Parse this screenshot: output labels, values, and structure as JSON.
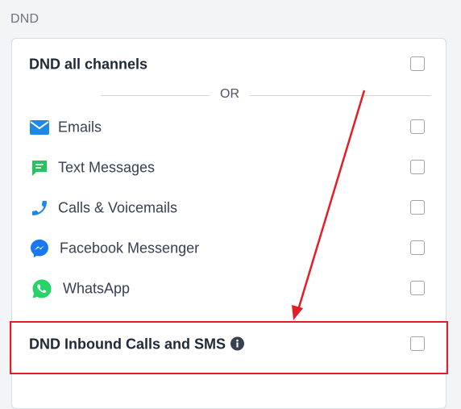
{
  "section": {
    "title": "DND"
  },
  "dnd_all": {
    "label": "DND all channels",
    "checked": false
  },
  "divider": {
    "text": "OR"
  },
  "channels": [
    {
      "label": "Emails",
      "icon": "email-icon",
      "icon_color": "#1e88e5",
      "checked": false
    },
    {
      "label": "Text Messages",
      "icon": "chat-icon",
      "icon_color": "#22c55e",
      "checked": false
    },
    {
      "label": "Calls & Voicemails",
      "icon": "phone-icon",
      "icon_color": "#1e88e5",
      "checked": false
    },
    {
      "label": "Facebook Messenger",
      "icon": "messenger-icon",
      "icon_color": "#1877f2",
      "checked": false
    },
    {
      "label": "WhatsApp",
      "icon": "whatsapp-icon",
      "icon_color": "#25d366",
      "checked": false
    }
  ],
  "inbound": {
    "label": "DND Inbound Calls and SMS",
    "checked": false,
    "info_icon": "info-icon"
  },
  "annotation": {
    "color": "#e41e26"
  }
}
